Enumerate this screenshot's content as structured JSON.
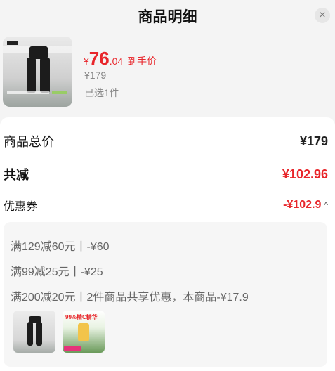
{
  "header": {
    "title": "商品明细",
    "close_glyph": "×"
  },
  "product": {
    "price_currency": "¥",
    "price_integer": "76",
    "price_decimal": ".04",
    "price_suffix": "到手价",
    "original_price": "¥179",
    "selected_text": "已选1件"
  },
  "summary": {
    "total_label": "商品总价",
    "total_value": "¥179",
    "reduction_label": "共减",
    "reduction_value": "¥102.96",
    "coupon_label": "优惠券",
    "coupon_value": "-¥102.9",
    "coupon_chevron": "^"
  },
  "discounts": [
    "满129减60元丨-¥60",
    "满99减25元丨-¥25",
    "满200减20元丨2件商品共享优惠，本商品-¥17.9"
  ],
  "shared_items": [
    {
      "name": "pants-thumbnail"
    },
    {
      "name": "supplement-thumbnail",
      "badge": "99%精C精华"
    }
  ],
  "colors": {
    "accent_red": "#e8262b",
    "panel_bg": "#ffffff",
    "page_bg": "#f4f4f4"
  }
}
